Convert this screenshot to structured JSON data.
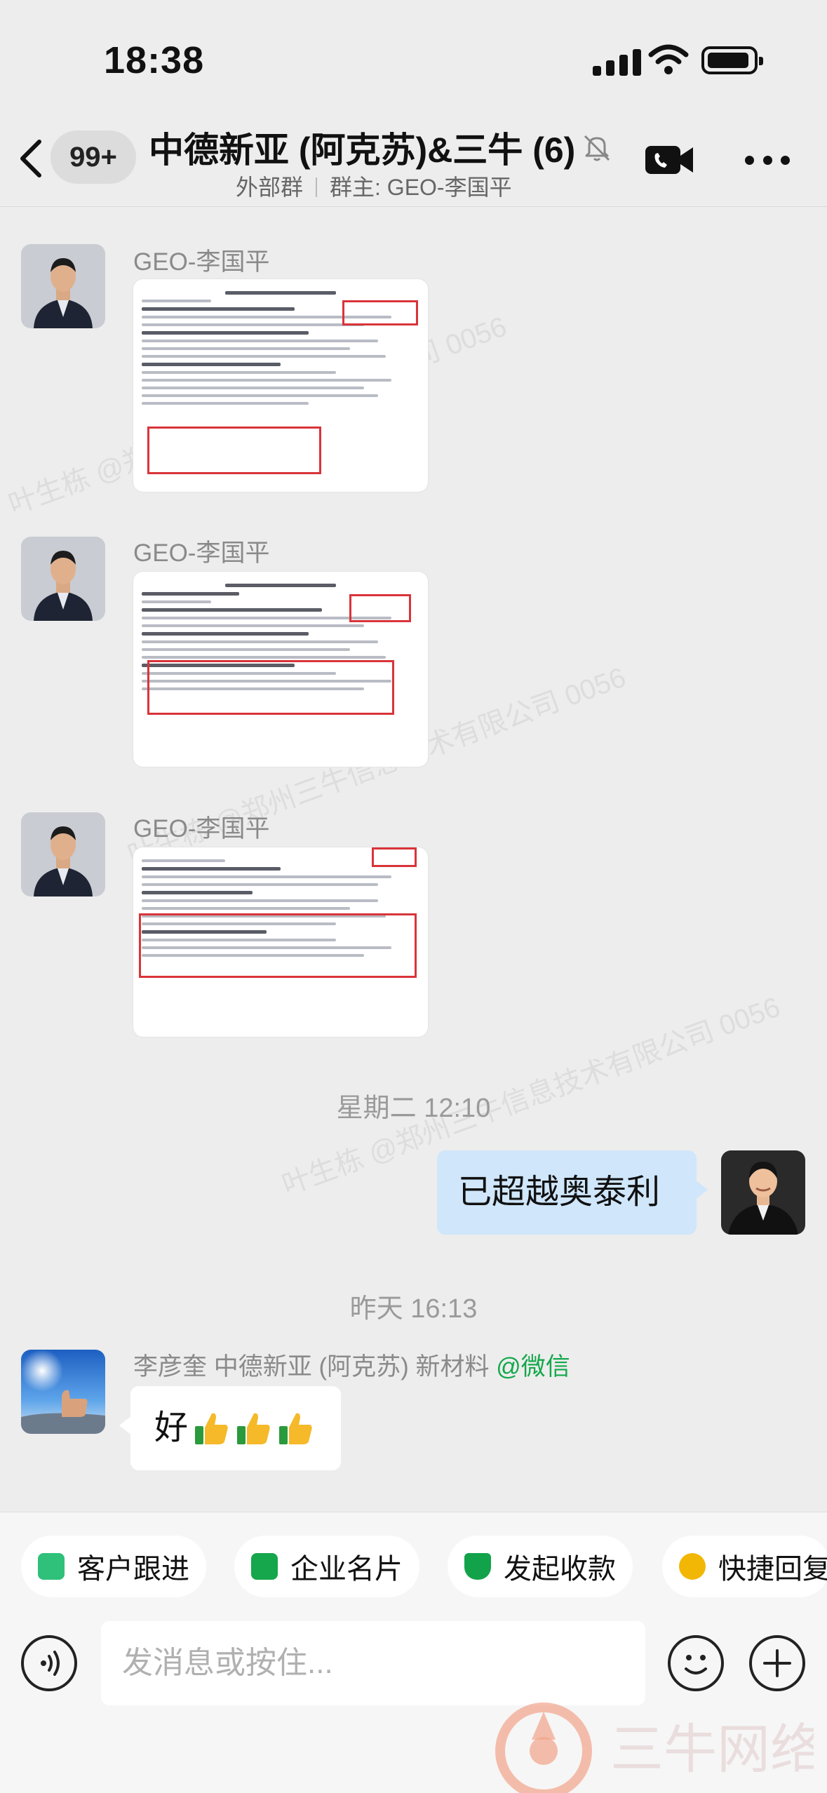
{
  "status": {
    "time": "18:38"
  },
  "header": {
    "badge": "99+",
    "title": "中德新亚 (阿克苏)&三牛 (6)",
    "group_type": "外部群",
    "owner": "群主: GEO-李国平"
  },
  "messages": {
    "m1": {
      "sender": "GEO-李国平"
    },
    "m2": {
      "sender": "GEO-李国平"
    },
    "m3": {
      "sender": "GEO-李国平"
    },
    "ts1": "星期二 12:10",
    "m4": {
      "text": "已超越奥泰利"
    },
    "ts2": "昨天 16:13",
    "m5": {
      "sender_name": "李彦奎 中德新亚 (阿克苏) 新材料 ",
      "sender_tag": "@微信",
      "text": "好"
    }
  },
  "toolbar": {
    "chips": [
      "客户跟进",
      "企业名片",
      "发起收款",
      "快捷回复"
    ],
    "input_placeholder": "发消息或按住..."
  },
  "colors": {
    "accent_green": "#13a84a",
    "bubble_blue": "#cfe6fb",
    "red_dot": "#f0443a"
  },
  "watermark": [
    "叶生栋 @郑州三牛信息技术有限公司 0056"
  ],
  "logo_text": "三牛网络"
}
